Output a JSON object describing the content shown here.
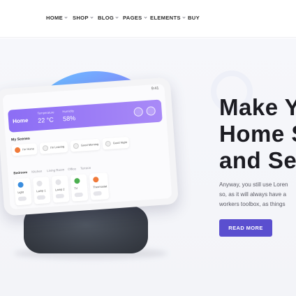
{
  "nav": {
    "items": [
      {
        "label": "HOME",
        "has_dropdown": true
      },
      {
        "label": "SHOP",
        "has_dropdown": true
      },
      {
        "label": "BLOG",
        "has_dropdown": true
      },
      {
        "label": "PAGES",
        "has_dropdown": true
      },
      {
        "label": "ELEMENTS",
        "has_dropdown": true
      },
      {
        "label": "BUY",
        "has_dropdown": false
      }
    ]
  },
  "device": {
    "time": "9:41",
    "banner": {
      "title": "Home",
      "temperature_label": "Temperature",
      "temperature_value": "22 °C",
      "humidity_label": "Humidity",
      "humidity_value": "58%"
    },
    "scenes_title": "My Scenes",
    "scenes": [
      "I'm Home",
      "I'm Leaving",
      "Good Morning",
      "Good Night"
    ],
    "rooms": [
      "Bedroom",
      "Kitchen",
      "Living Room",
      "Office",
      "Terrace"
    ],
    "devices": [
      {
        "name": "Light",
        "icon": "lightbulb-icon",
        "color": "#3a8dde"
      },
      {
        "name": "Lamp 1",
        "icon": "lamp-icon",
        "color": "#e4e4e8"
      },
      {
        "name": "Lamp 2",
        "icon": "lamp-icon",
        "color": "#e4e4e8"
      },
      {
        "name": "TV",
        "icon": "tv-icon",
        "color": "#4caf50"
      },
      {
        "name": "Thermostat",
        "icon": "thermostat-icon",
        "color": "#f07a3a"
      }
    ]
  },
  "hero": {
    "headline_lines": [
      "Make Y",
      "Home S",
      "and Se"
    ],
    "body_lines": [
      "Anyway, you still use Loren",
      "so, as it will always have a",
      "workers toolbox, as things"
    ],
    "cta_label": "READ MORE"
  },
  "colors": {
    "accent": "#5a4fcf",
    "banner": "#8c6df5",
    "headline": "#1c1c22"
  }
}
